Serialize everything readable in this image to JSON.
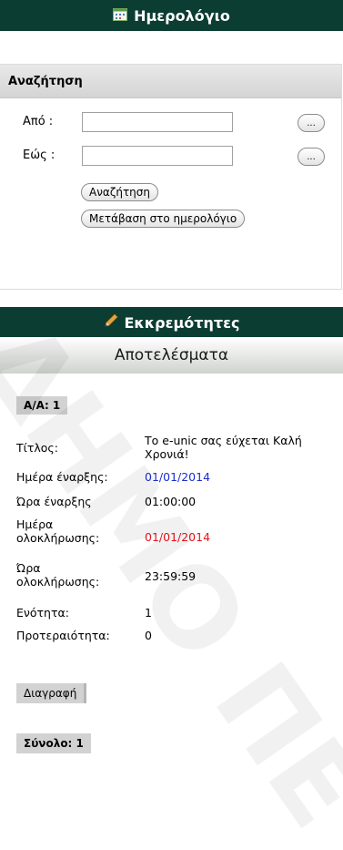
{
  "calendar_header": {
    "title": "Ημερολόγιο",
    "icon": "calendar-icon"
  },
  "search": {
    "title": "Αναζήτηση",
    "from_label": "Από :",
    "to_label": "Εώς :",
    "from_value": "",
    "to_value": "",
    "picker_label": "...",
    "search_button": "Αναζήτηση",
    "goto_button": "Μετάβαση στο ημερολόγιο"
  },
  "pending_header": {
    "title": "Εκκρεμότητες",
    "icon": "pencil-icon"
  },
  "results": {
    "title": "Αποτελέσματα",
    "item_tag": "Α/Α: 1",
    "fields": {
      "title_label": "Τίτλος:",
      "title_value": "Το e-unic σας εύχεται Καλή Χρονιά!",
      "start_date_label": "Ημέρα έναρξης:",
      "start_date_value": "01/01/2014",
      "start_time_label": "Ώρα έναρξης",
      "start_time_value": "01:00:00",
      "end_date_label": "Ημέρα ολοκλήρωσης:",
      "end_date_value": "01/01/2014",
      "end_time_label": "Ώρα ολοκλήρωσης:",
      "end_time_value": "23:59:59",
      "section_label": "Ενότητα:",
      "section_value": "1",
      "priority_label": "Προτεραιότητα:",
      "priority_value": "0"
    },
    "delete_button": "Διαγραφή",
    "total": "Σύνολο: 1"
  },
  "watermark": "ΔΗΜΟ ΠΕ",
  "colors": {
    "header_bg": "#0c3d33",
    "start_date": "#1a2fcf",
    "end_date": "#e8161c"
  }
}
